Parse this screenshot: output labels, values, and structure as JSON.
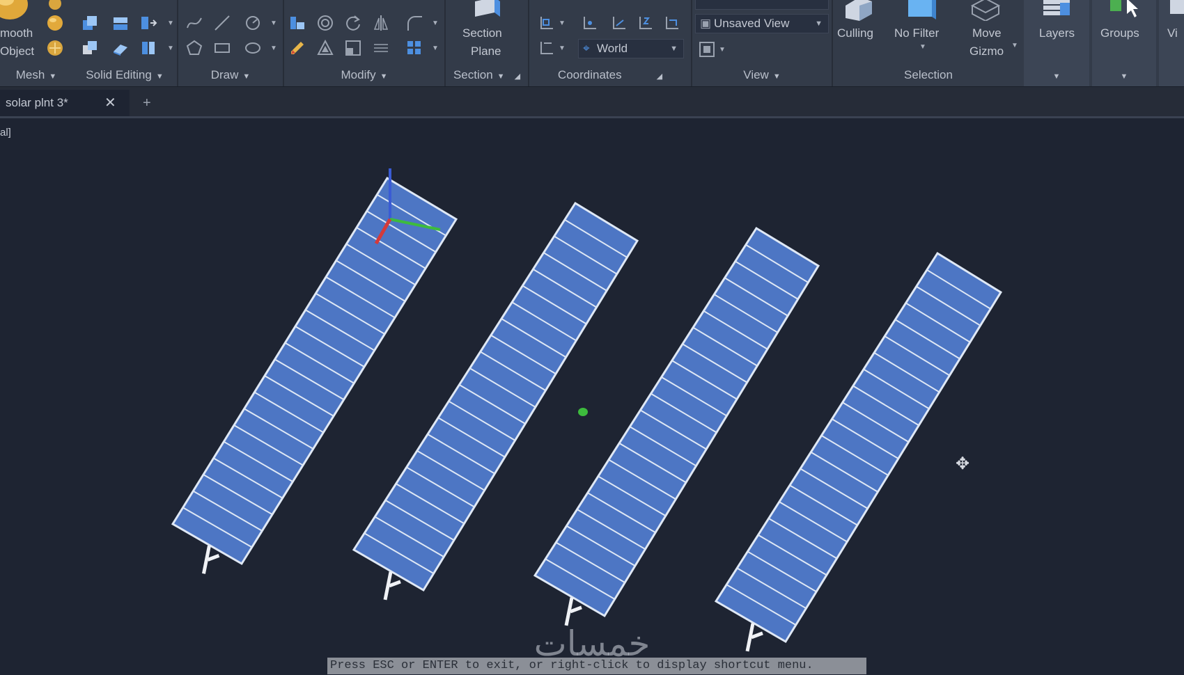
{
  "ribbon": {
    "panels": {
      "mesh": {
        "title": "Mesh",
        "big_label_1": "mooth",
        "big_label_2": "Object"
      },
      "solid_editing": {
        "title": "Solid Editing"
      },
      "draw": {
        "title": "Draw"
      },
      "modify": {
        "title": "Modify"
      },
      "section": {
        "title": "Section",
        "button_label_1": "Section",
        "button_label_2": "Plane"
      },
      "coordinates": {
        "title": "Coordinates",
        "ucs_value": "World"
      },
      "view": {
        "title": "View",
        "named_view": "Unsaved View"
      },
      "selection": {
        "title": "Selection",
        "culling_label": "Culling",
        "filter_label": "No Filter",
        "gizmo_label_1": "Move",
        "gizmo_label_2": "Gizmo"
      },
      "layers": {
        "label": "Layers"
      },
      "groups": {
        "label": "Groups"
      },
      "view_partial": {
        "label": "Vi"
      }
    }
  },
  "tabs": {
    "active_label": "solar plnt 3*",
    "close_glyph": "✕",
    "add_glyph": "+"
  },
  "viewport": {
    "label": "al]"
  },
  "status": {
    "prompt": "Press ESC or ENTER to exit, or right-click to display shortcut menu."
  },
  "watermark": {
    "text": "خمسات"
  },
  "colors": {
    "ribbon_bg": "#333b49",
    "viewport_bg": "#1e2432",
    "panel_fill": "#4d76c4",
    "panel_outline": "#dfe8f5",
    "axis_x": "#d43a3a",
    "axis_y": "#3dbb3d",
    "axis_z": "#3a5bd4"
  },
  "icons": {
    "cursor": "orbit-cursor-icon"
  }
}
